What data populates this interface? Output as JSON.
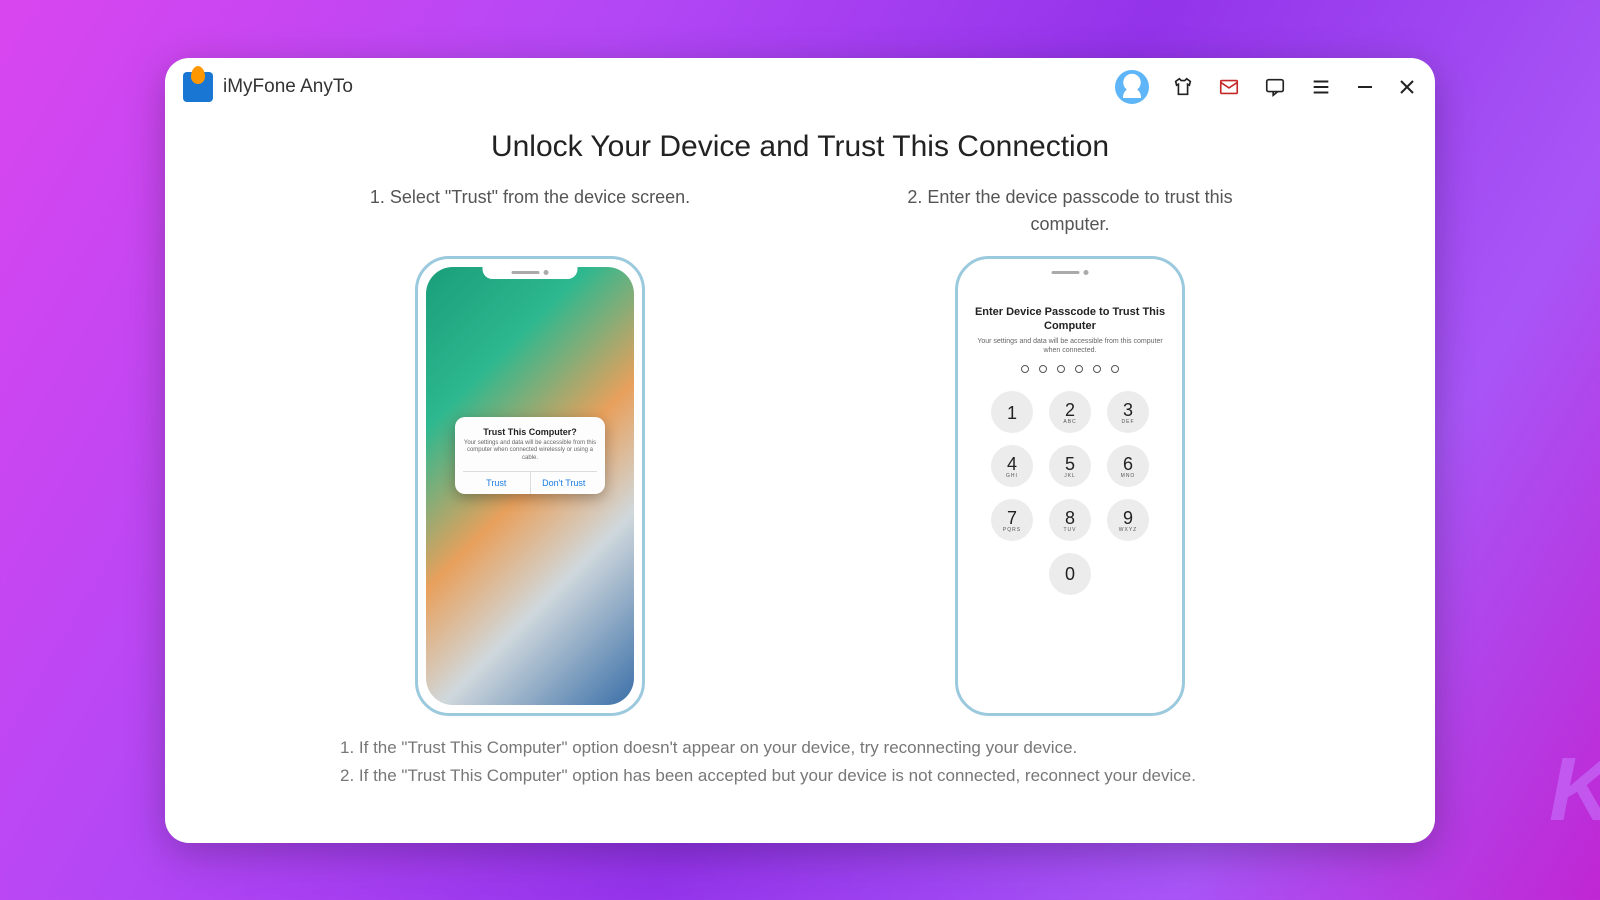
{
  "app": {
    "title": "iMyFone AnyTo"
  },
  "icons": {
    "account": "account-icon",
    "shirt": "shirt-icon",
    "mail": "mail-icon",
    "feedback": "feedback-icon",
    "menu": "menu-icon",
    "minimize": "minimize-icon",
    "close": "close-icon"
  },
  "page": {
    "heading": "Unlock Your Device and Trust This Connection",
    "step1_label": "1. Select \"Trust\" from the device screen.",
    "step2_label": "2. Enter the device passcode to trust this computer."
  },
  "trust_dialog": {
    "title": "Trust This Computer?",
    "body": "Your settings and data will be accessible from this computer when connected wirelessly or using a cable.",
    "trust": "Trust",
    "dont_trust": "Don't Trust"
  },
  "passcode": {
    "title": "Enter Device Passcode to Trust This Computer",
    "subtitle": "Your settings and data will be accessible from this computer when connected.",
    "keys": [
      {
        "n": "1",
        "s": ""
      },
      {
        "n": "2",
        "s": "ABC"
      },
      {
        "n": "3",
        "s": "DEF"
      },
      {
        "n": "4",
        "s": "GHI"
      },
      {
        "n": "5",
        "s": "JKL"
      },
      {
        "n": "6",
        "s": "MNO"
      },
      {
        "n": "7",
        "s": "PQRS"
      },
      {
        "n": "8",
        "s": "TUV"
      },
      {
        "n": "9",
        "s": "WXYZ"
      },
      {
        "n": "0",
        "s": ""
      }
    ]
  },
  "notes": {
    "n1": "1. If the \"Trust This Computer\" option doesn't appear on your device, try reconnecting your device.",
    "n2": "2. If the \"Trust This Computer\" option has been accepted but your device is not connected, reconnect your device."
  },
  "watermark": "K"
}
